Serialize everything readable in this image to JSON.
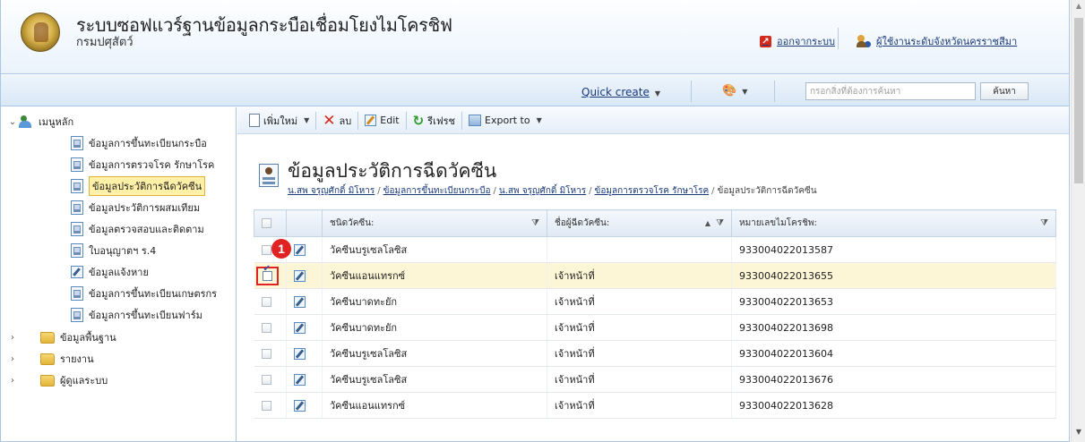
{
  "header": {
    "title": "ระบบซอฟแวร์ฐานข้อมูลกระบือเชื่อมโยงไมโครชิฟ",
    "subtitle": "กรมปศุสัตว์",
    "logout_label": "ออกจากระบบ",
    "user_label": "ผู้ใช้งานระดับจังหวัดนครราชสีมา"
  },
  "actionbar": {
    "quick_create": "Quick create",
    "search_placeholder": "กรอกสิ่งที่ต้องการค้นหา",
    "search_button": "ค้นหา"
  },
  "sidebar": {
    "root_label": "เมนูหลัก",
    "items": [
      {
        "label": "ข้อมูลการขึ้นทะเบียนกระบือ",
        "icon": "doc-icon"
      },
      {
        "label": "ข้อมูลการตรวจโรค รักษาโรค",
        "icon": "doc-icon"
      },
      {
        "label": "ข้อมูลประวัติการฉีดวัคซีน",
        "icon": "doc-icon"
      },
      {
        "label": "ข้อมูลประวัติการผสมเทียม",
        "icon": "doc-icon"
      },
      {
        "label": "ข้อมูลตรวจสอบและติดตาม",
        "icon": "doc-icon"
      },
      {
        "label": "ใบอนุญาตฯ ร.4",
        "icon": "doc-icon"
      },
      {
        "label": "ข้อมูลแจ้งหาย",
        "icon": "edit-icon"
      },
      {
        "label": "ข้อมูลการขึ้นทะเบียนเกษตรกร",
        "icon": "doc-icon"
      },
      {
        "label": "ข้อมูลการขึ้นทะเบียนฟาร์ม",
        "icon": "doc-icon"
      }
    ],
    "selected_index": 2,
    "folders": [
      "ข้อมูลพื้นฐาน",
      "รายงาน",
      "ผู้ดูแลระบบ"
    ]
  },
  "toolbar": {
    "new_label": "เพิ่มใหม่",
    "delete_label": "ลบ",
    "edit_label": "Edit",
    "refresh_label": "รีเฟรช",
    "export_label": "Export to"
  },
  "content": {
    "title": "ข้อมูลประวัติการฉีดวัคซีน",
    "breadcrumb": [
      "น.สพ จรุญศักดิ์ มิโหาร",
      "ข้อมูลการขึ้นทะเบียนกระบือ",
      "น.สพ จรุญศักดิ์ มิโหาร",
      "ข้อมูลการตรวจโรค รักษาโรค",
      "ข้อมูลประวัติการฉีดวัคซีน"
    ]
  },
  "grid": {
    "columns": [
      "ชนิดวัคซีน:",
      "ชื่อผู้ฉีดวัคซีน:",
      "หมายเลขไมโครชิพ:"
    ],
    "rows": [
      {
        "vaccine": "วัคซีนบรูเซลโลซิส",
        "injector": "",
        "chip": "933004022013587",
        "checked": false
      },
      {
        "vaccine": "วัคซีนแอนแทรกซ์",
        "injector": "เจ้าหน้าที่",
        "chip": "933004022013655",
        "checked": true
      },
      {
        "vaccine": "วัคซีนบาดทะยัก",
        "injector": "เจ้าหน้าที่",
        "chip": "933004022013653",
        "checked": false
      },
      {
        "vaccine": "วัคซีนบาดทะยัก",
        "injector": "เจ้าหน้าที่",
        "chip": "933004022013698",
        "checked": false
      },
      {
        "vaccine": "วัคซีนบรูเซลโลซิส",
        "injector": "เจ้าหน้าที่",
        "chip": "933004022013604",
        "checked": false
      },
      {
        "vaccine": "วัคซีนบรูเซลโลซิส",
        "injector": "เจ้าหน้าที่",
        "chip": "933004022013676",
        "checked": false
      },
      {
        "vaccine": "วัคซีนแอนแทรกซ์",
        "injector": "เจ้าหน้าที่",
        "chip": "933004022013628",
        "checked": false
      }
    ]
  },
  "annotation": {
    "step_number": "1"
  }
}
